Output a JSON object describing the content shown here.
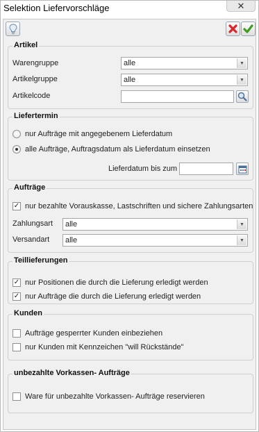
{
  "window": {
    "title": "Selektion Liefervorschläge",
    "close_glyph": "✕"
  },
  "toolbar": {
    "hint_icon": "lightbulb-icon",
    "cancel_icon": "cancel-x-icon",
    "ok_icon": "checkmark-icon"
  },
  "artikel": {
    "title": "Artikel",
    "warengruppe_label": "Warengruppe",
    "warengruppe_value": "alle",
    "artikelgruppe_label": "Artikelgruppe",
    "artikelgruppe_value": "alle",
    "artikelcode_label": "Artikelcode",
    "artikelcode_value": ""
  },
  "liefertermin": {
    "title": "Liefertermin",
    "option1": "nur Aufträge mit angegebenem Lieferdatum",
    "option2": "alle Aufträge, Auftragsdatum als Lieferdatum einsetzen",
    "selected_option": 2,
    "lieferdatum_label": "Lieferdatum bis zum",
    "lieferdatum_value": ""
  },
  "auftraege": {
    "title": "Aufträge",
    "vorauskasse_label": "nur bezahlte Vorauskasse, Lastschriften und sichere Zahlungsarten",
    "vorauskasse_checked": true,
    "zahlungsart_label": "Zahlungsart",
    "zahlungsart_value": "alle",
    "versandart_label": "Versandart",
    "versandart_value": "alle"
  },
  "teillieferungen": {
    "title": "Teillieferungen",
    "positionen_label": "nur Positionen die durch die Lieferung erledigt werden",
    "positionen_checked": true,
    "auftraege_label": "nur Aufträge die durch die Lieferung erledigt werden",
    "auftraege_checked": true
  },
  "kunden": {
    "title": "Kunden",
    "gesperrte_label": "Aufträge gesperrter Kunden einbeziehen",
    "gesperrte_checked": false,
    "kennzeichen_label": "nur Kunden mit Kennzeichen \"will Rückstände\"",
    "kennzeichen_checked": false
  },
  "vorkassen": {
    "title": "unbezahlte Vorkassen- Aufträge",
    "reservieren_label": "Ware für unbezahlte Vorkassen- Aufträge reservieren",
    "reservieren_checked": false
  },
  "colors": {
    "cancel_red": "#d8262a",
    "ok_green": "#3f9a1e",
    "panel_bg": "#f0f0f0"
  }
}
